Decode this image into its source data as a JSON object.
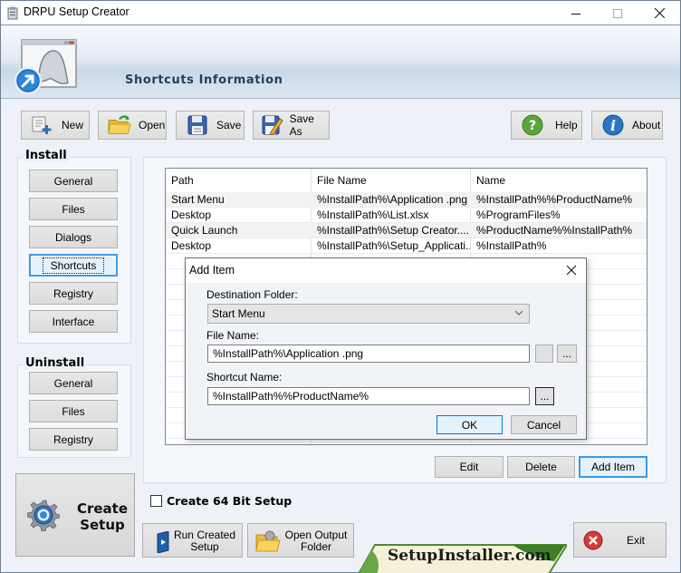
{
  "window": {
    "title": "DRPU Setup Creator",
    "controls": {
      "minimize": "minimize",
      "maximize": "maximize",
      "close": "close"
    }
  },
  "header": {
    "title": "Shortcuts Information",
    "logo_icon": "setup-shortcut-logo-icon"
  },
  "toolbar": {
    "new_label": "New",
    "open_label": "Open",
    "save_label": "Save",
    "save_as_label": "Save As",
    "help_label": "Help",
    "about_label": "About"
  },
  "sidebar": {
    "install_title": "Install",
    "install_items": [
      {
        "label": "General",
        "active": false
      },
      {
        "label": "Files",
        "active": false
      },
      {
        "label": "Dialogs",
        "active": false
      },
      {
        "label": "Shortcuts",
        "active": true
      },
      {
        "label": "Registry",
        "active": false
      },
      {
        "label": "Interface",
        "active": false
      }
    ],
    "uninstall_title": "Uninstall",
    "uninstall_items": [
      {
        "label": "General"
      },
      {
        "label": "Files"
      },
      {
        "label": "Registry"
      }
    ]
  },
  "table": {
    "columns": [
      "Path",
      "File Name",
      "Name"
    ],
    "rows": [
      [
        "Start Menu",
        "%InstallPath%\\Application .png",
        "%InstallPath%%ProductName%"
      ],
      [
        "Desktop",
        "%InstallPath%\\List.xlsx",
        "%ProgramFiles%"
      ],
      [
        "Quick Launch",
        "%InstallPath%\\Setup Creator....",
        "%ProductName%%InstallPath%"
      ],
      [
        "Desktop",
        "%InstallPath%\\Setup_Applicati...",
        "%InstallPath%"
      ]
    ]
  },
  "actions": {
    "edit_label": "Edit",
    "delete_label": "Delete",
    "add_item_label": "Add Item"
  },
  "dialog": {
    "title": "Add Item",
    "destination_label": "Destination Folder:",
    "destination_value": "Start Menu",
    "file_name_label": "File Name:",
    "file_name_value": "%InstallPath%\\Application .png",
    "shortcut_name_label": "Shortcut Name:",
    "shortcut_name_value": "%InstallPath%%ProductName%",
    "browse_label": "...",
    "ok_label": "OK",
    "cancel_label": "Cancel"
  },
  "bottom": {
    "create_setup_line1": "Create",
    "create_setup_line2": "Setup",
    "checkbox_label": "Create 64 Bit Setup",
    "checkbox_checked": false,
    "run_setup_line1": "Run Created",
    "run_setup_line2": "Setup",
    "open_output_line1": "Open Output",
    "open_output_line2": "Folder",
    "banner_text": "SetupInstaller.com",
    "exit_label": "Exit"
  }
}
